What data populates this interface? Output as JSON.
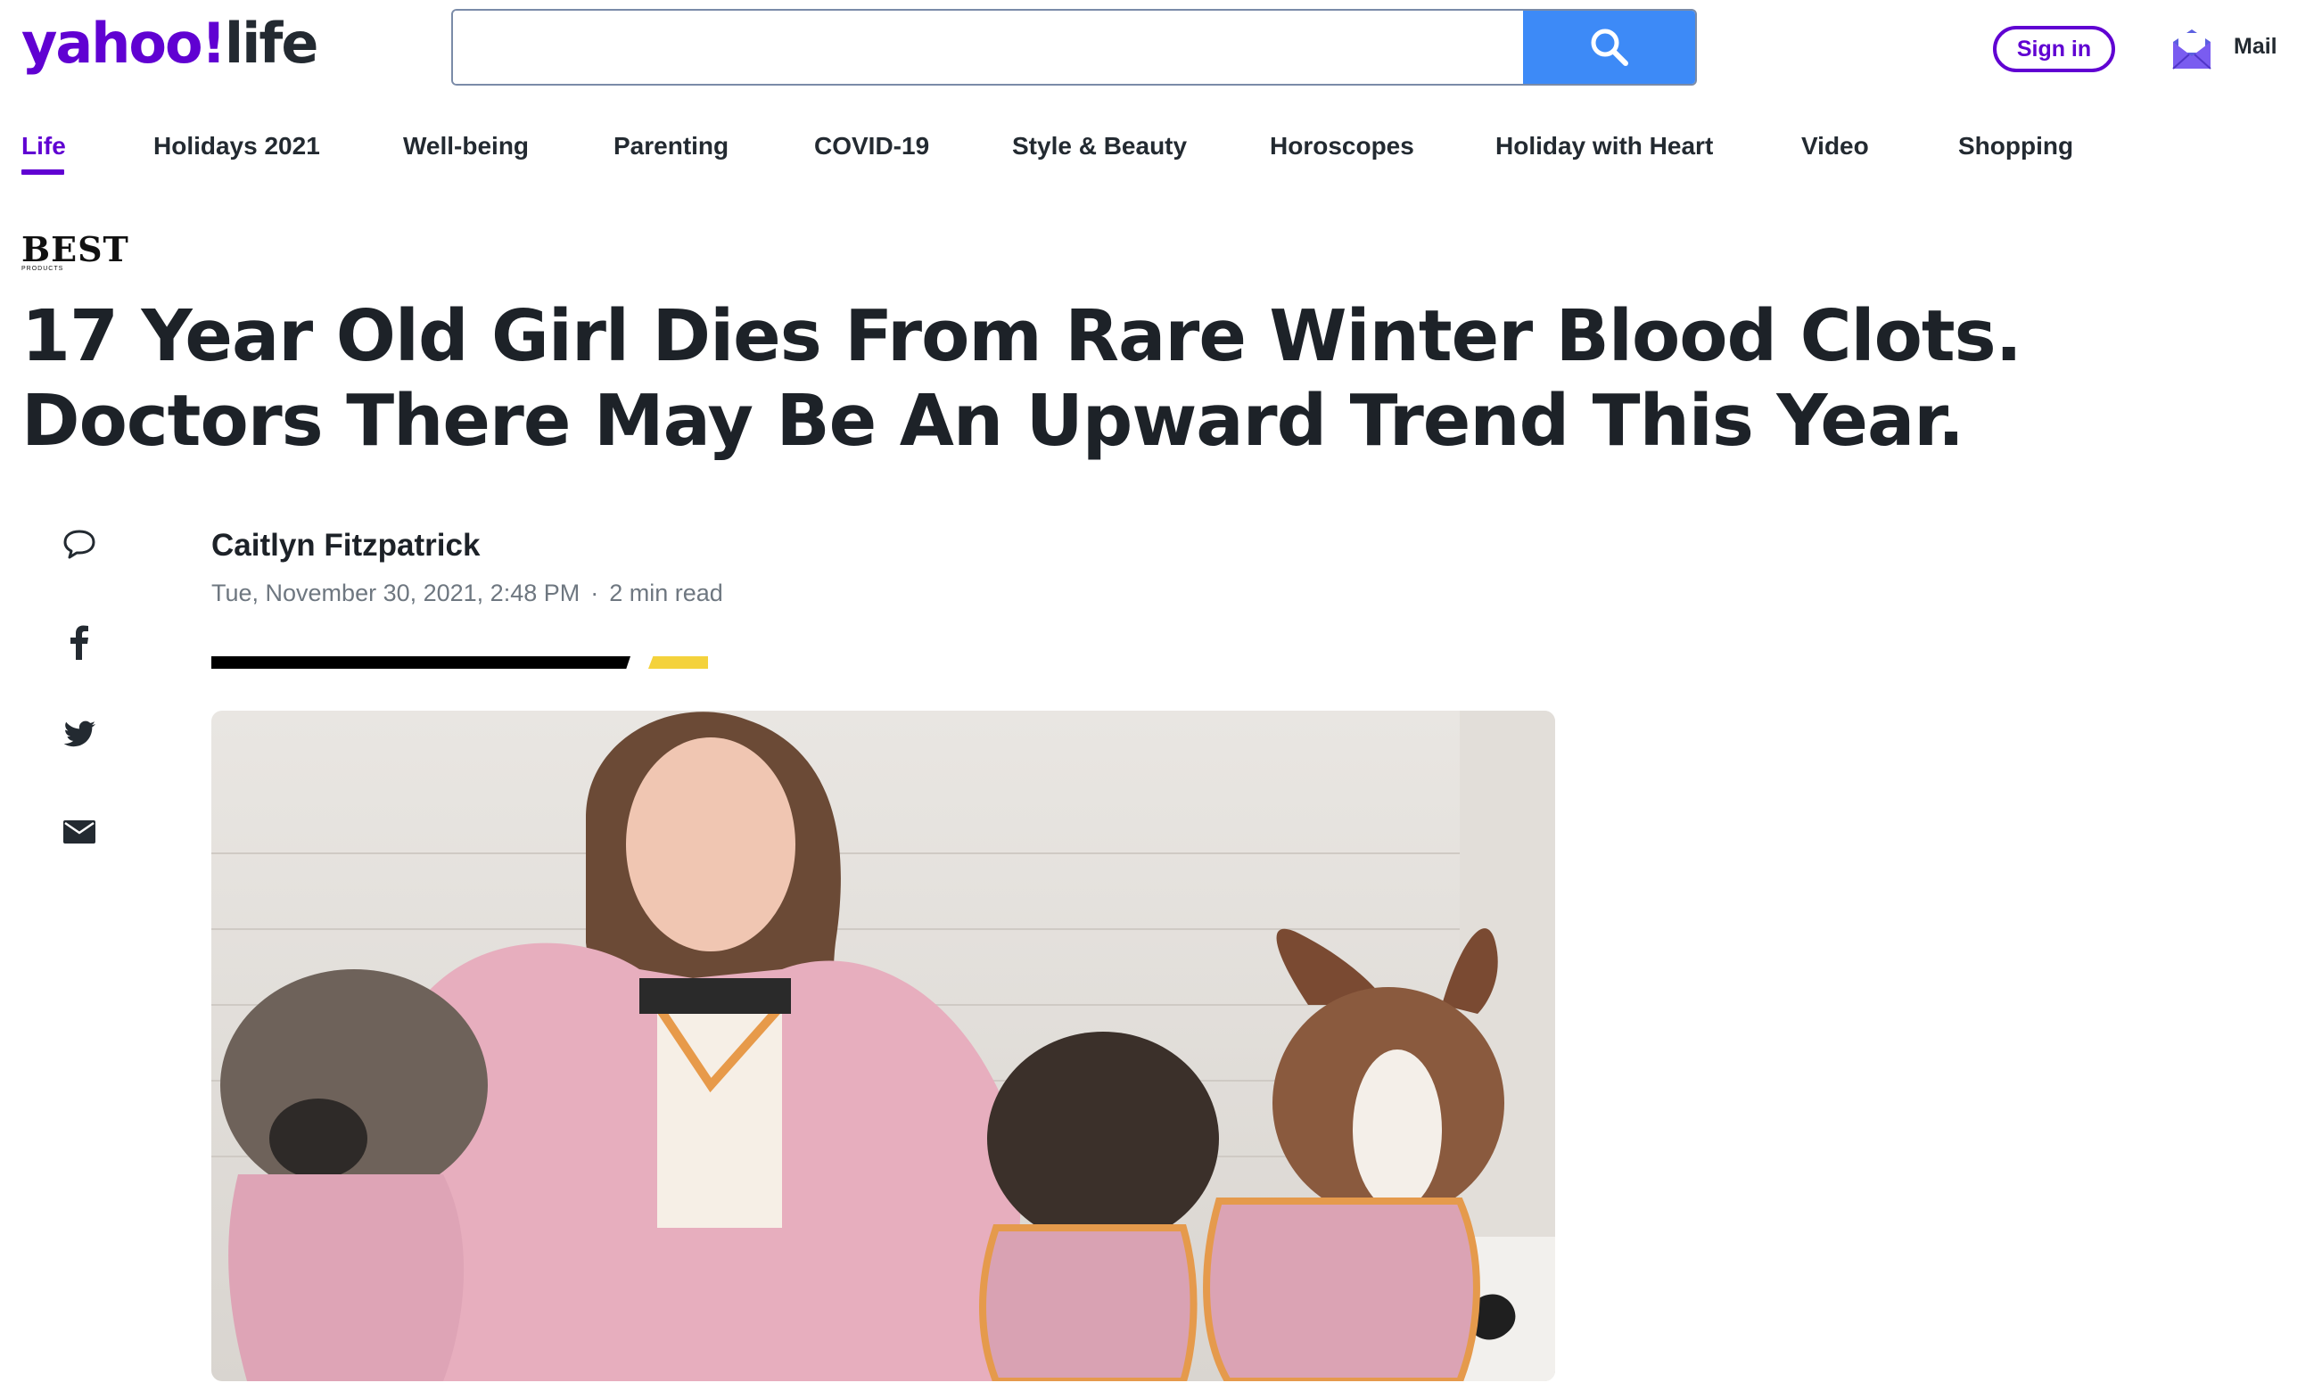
{
  "header": {
    "logo_main": "yahoo!",
    "logo_section": "life",
    "search": {
      "value": "",
      "placeholder": ""
    },
    "sign_in_label": "Sign in",
    "mail_label": "Mail"
  },
  "nav": {
    "items": [
      {
        "label": "Life",
        "active": true
      },
      {
        "label": "Holidays 2021"
      },
      {
        "label": "Well-being"
      },
      {
        "label": "Parenting"
      },
      {
        "label": "COVID-19"
      },
      {
        "label": "Style & Beauty"
      },
      {
        "label": "Horoscopes"
      },
      {
        "label": "Holiday with Heart"
      },
      {
        "label": "Video"
      },
      {
        "label": "Shopping"
      }
    ]
  },
  "article": {
    "source_brand": "BEST",
    "source_brand_sub": "PRODUCTS",
    "headline": "17 Year Old Girl Dies From Rare Winter Blood Clots. Doctors There May Be An Upward Trend This Year.",
    "author": "Caitlyn Fitzpatrick",
    "date": "Tue, November 30, 2021, 2:48 PM",
    "separator": "·",
    "read_time": "2 min read"
  },
  "share_icons": [
    "comment-icon",
    "facebook-icon",
    "twitter-icon",
    "email-icon"
  ],
  "colors": {
    "brand_purple": "#6001d2",
    "search_blue": "#3d8af7",
    "accent_yellow": "#f4d23c",
    "text_dark": "#1d2228",
    "text_meta": "#6e7780"
  }
}
